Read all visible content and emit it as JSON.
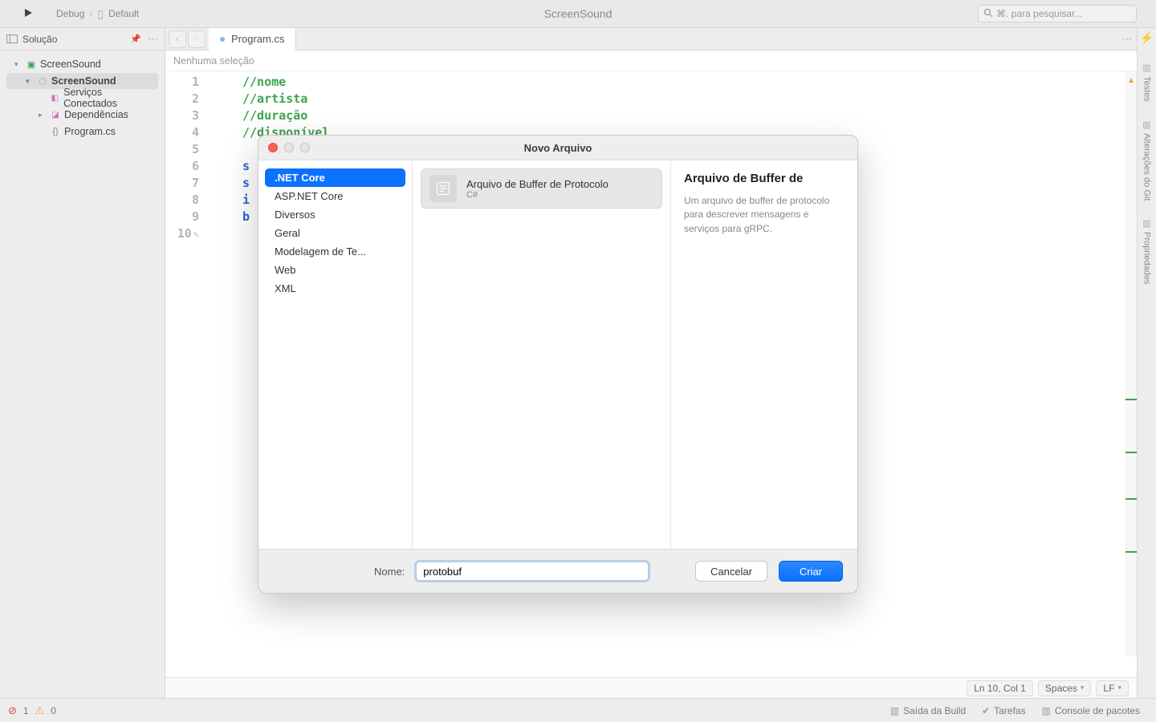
{
  "titlebar": {
    "crumbs": {
      "config": "Debug",
      "target": "Default"
    },
    "app_title": "ScreenSound",
    "search_placeholder": "⌘. para pesquisar..."
  },
  "sidebar": {
    "header": "Solução",
    "tree": {
      "solution": "ScreenSound",
      "project": "ScreenSound",
      "connected_services": "Serviços Conectados",
      "dependencies": "Dependências",
      "program_file": "Program.cs"
    }
  },
  "tabs": {
    "active": "Program.cs"
  },
  "breadcrumb": "Nenhuma seleção",
  "code": {
    "lines": [
      {
        "n": "1",
        "kind": "comment",
        "text": "//nome"
      },
      {
        "n": "2",
        "kind": "comment",
        "text": "//artista"
      },
      {
        "n": "3",
        "kind": "comment",
        "text": "//duração"
      },
      {
        "n": "4",
        "kind": "comment",
        "text": "//disponível"
      },
      {
        "n": "5",
        "kind": "blank",
        "text": ""
      },
      {
        "n": "6",
        "kind": "kw",
        "text": "s"
      },
      {
        "n": "7",
        "kind": "kw",
        "text": "s"
      },
      {
        "n": "8",
        "kind": "kw",
        "text": "i"
      },
      {
        "n": "9",
        "kind": "kw",
        "text": "b"
      },
      {
        "n": "10",
        "kind": "cursor",
        "text": ""
      }
    ]
  },
  "editor_status": {
    "position": "Ln 10, Col 1",
    "indent": "Spaces",
    "line_endings": "LF"
  },
  "right_rail": {
    "tab1": "Testes",
    "tab2": "Alterações do Git",
    "tab3": "Propriedades"
  },
  "bottom": {
    "errors": "1",
    "warnings": "0",
    "panels": {
      "build": "Saída da Build",
      "tasks": "Tarefas",
      "packages": "Console de pacotes"
    }
  },
  "modal": {
    "title": "Novo Arquivo",
    "categories": [
      ".NET Core",
      "ASP.NET Core",
      "Diversos",
      "Geral",
      "Modelagem de Te...",
      "Web",
      "XML"
    ],
    "selected_category": 0,
    "template": {
      "title": "Arquivo de Buffer de Protocolo",
      "subtitle": "C#"
    },
    "desc": {
      "heading": "Arquivo de Buffer de",
      "body": "Um arquivo de buffer de protocolo para descrever mensagens e serviços para gRPC."
    },
    "name_label": "Nome:",
    "name_value": "protobuf",
    "cancel": "Cancelar",
    "create": "Criar"
  }
}
